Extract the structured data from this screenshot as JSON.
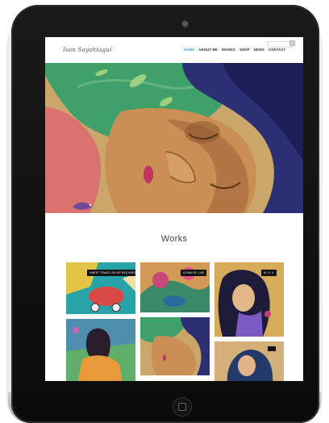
{
  "site": {
    "logo_text": "Ivan Sayahtaguí"
  },
  "nav": {
    "items": [
      {
        "label": "HOME",
        "active": true
      },
      {
        "label": "ABOUT ME",
        "active": false
      },
      {
        "label": "WORKS",
        "active": false
      },
      {
        "label": "SHOP",
        "active": false
      },
      {
        "label": "NEWS",
        "active": false
      },
      {
        "label": "CONTACT",
        "active": false
      }
    ]
  },
  "hero": {
    "slide_count": 3,
    "active_slide": 2
  },
  "works": {
    "title": "Works",
    "tiles": [
      {
        "label": "SWEET TRAVEL ON MY RED BIRD"
      },
      {
        "label": "A RAIN OF LIKE"
      },
      {
        "label": "M. O. X."
      },
      {
        "label": ""
      },
      {
        "label": ""
      },
      {
        "label": ""
      }
    ]
  },
  "colors": {
    "accent": "#3bb0d9",
    "tablet": "#0d0d0d"
  }
}
